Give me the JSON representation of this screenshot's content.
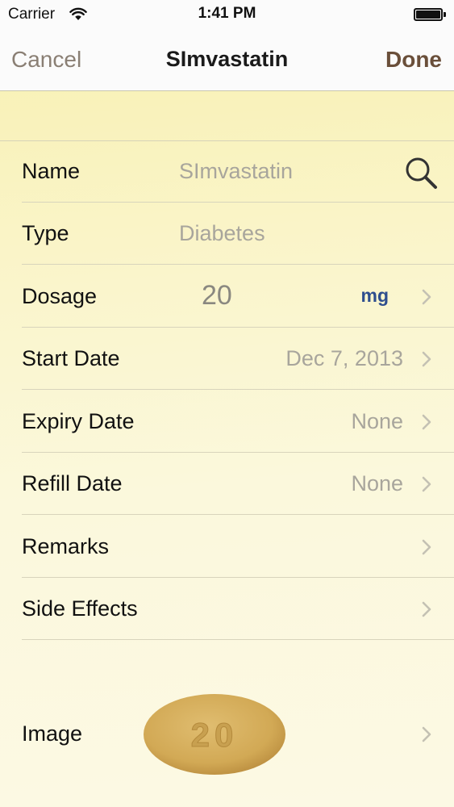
{
  "status_bar": {
    "carrier": "Carrier",
    "time": "1:41 PM",
    "wifi_icon": "wifi-icon",
    "battery_icon": "battery-full-icon"
  },
  "nav": {
    "cancel_label": "Cancel",
    "title": "SImvastatin",
    "done_label": "Done"
  },
  "form": {
    "name": {
      "label": "Name",
      "value": "SImvastatin",
      "icon": "search-icon"
    },
    "type": {
      "label": "Type",
      "value": "Diabetes"
    },
    "dosage": {
      "label": "Dosage",
      "amount": "20",
      "unit": "mg"
    },
    "start_date": {
      "label": "Start Date",
      "value": "Dec 7, 2013"
    },
    "expiry_date": {
      "label": "Expiry Date",
      "value": "None"
    },
    "refill_date": {
      "label": "Refill Date",
      "value": "None"
    },
    "remarks": {
      "label": "Remarks"
    },
    "side_effects": {
      "label": "Side Effects"
    },
    "image": {
      "label": "Image",
      "pill_imprint": "20"
    }
  },
  "colors": {
    "nav_cancel": "#8a7f74",
    "nav_done": "#6a4f3a",
    "dosage_unit": "#2e4e8e",
    "placeholder_text": "#a8a59c",
    "pill": "#d4ad5c"
  }
}
